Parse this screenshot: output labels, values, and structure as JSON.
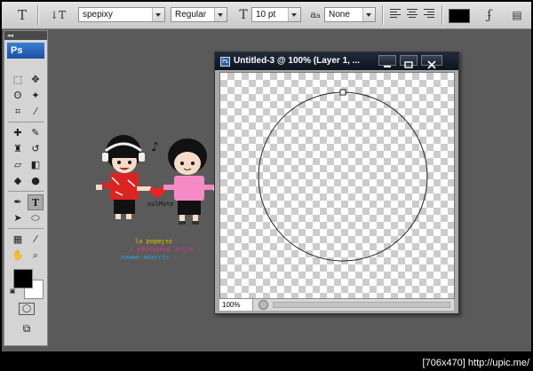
{
  "options_bar": {
    "tool_icon": "type-tool-icon",
    "orientation_icon": "text-orientation-icon",
    "font_family": "spepixy",
    "font_style": "Regular",
    "font_size": "10 pt",
    "antialias_label": "a",
    "antialias_label_sub": "a",
    "antialias": "None",
    "text_color": "#000000"
  },
  "toolbox": {
    "app_badge": "Ps",
    "collapse_label": "◂◂",
    "foreground_color": "#000000",
    "background_color": "#ffffff"
  },
  "document": {
    "title": "Untitled-3 @ 100% (Layer 1, ...",
    "icon_label": "Ps",
    "zoom": "100%"
  },
  "illustration": {
    "caption": "oulMate",
    "lines": [
      "lo popeyez",
      "r photoshop trick",
      "nowwo-anarric"
    ]
  },
  "watermark": {
    "text": "[706x470] http://upic.me/"
  }
}
